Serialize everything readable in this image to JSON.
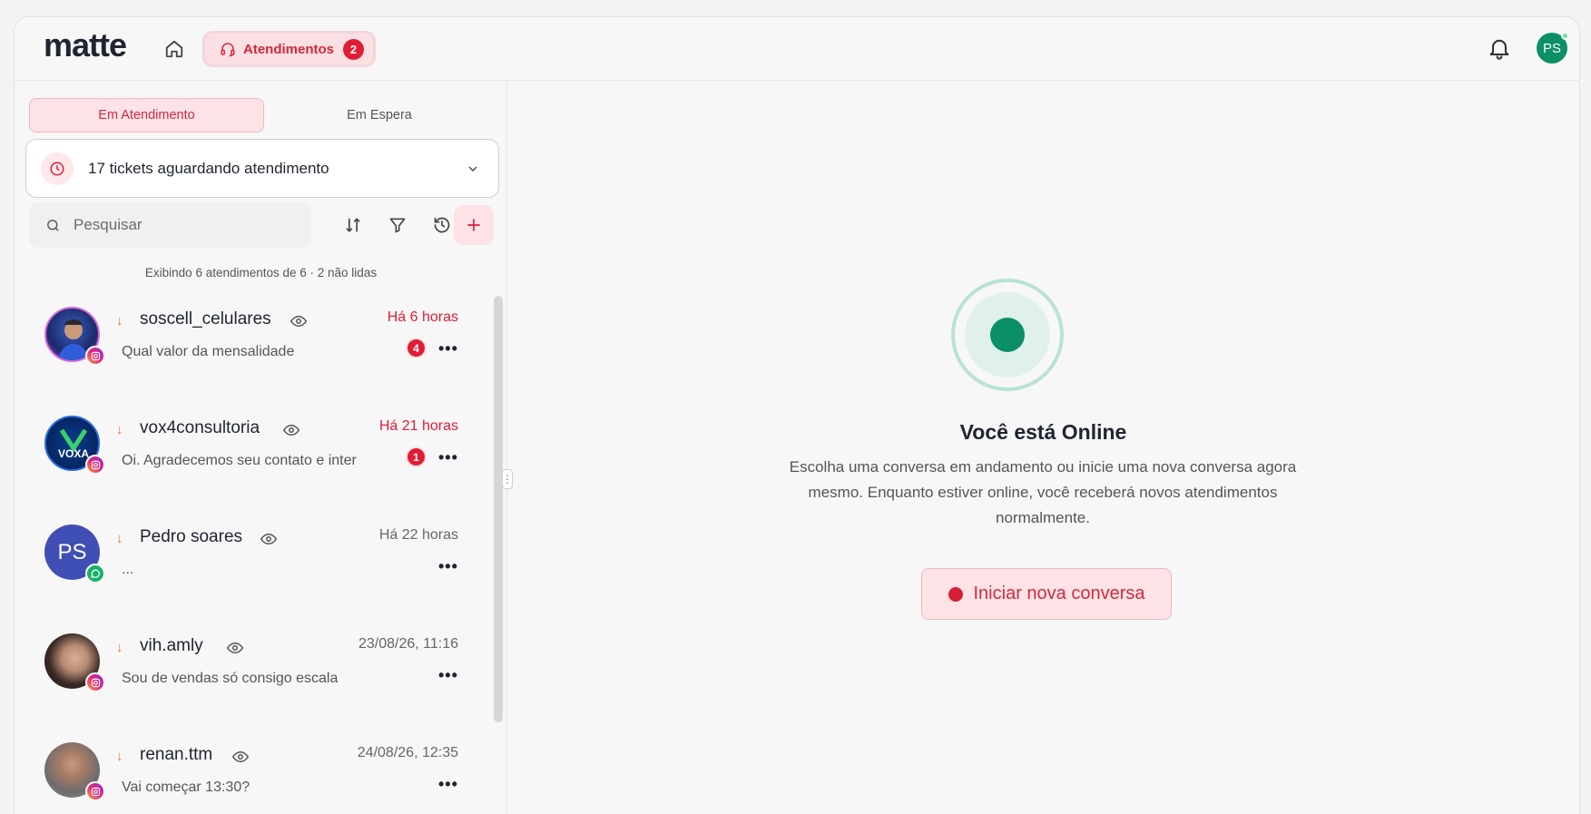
{
  "header": {
    "logo_text": "matte",
    "attendances_label": "Atendimentos",
    "attendances_badge": "2",
    "user_initials": "PS"
  },
  "sidebar": {
    "tabs": [
      {
        "label": "Em Atendimento",
        "active": true
      },
      {
        "label": "Em Espera",
        "active": false
      }
    ],
    "waiting_text": "17 tickets aguardando atendimento",
    "search_placeholder": "Pesquisar",
    "count_text": "Exibindo 6 atendimentos de 6 · 2 não lidas",
    "conversations": [
      {
        "name": "soscell_celulares",
        "time": "Há 6 horas",
        "time_urgent": true,
        "message": "Qual valor da mensalidade",
        "unread": "4",
        "channel": "instagram",
        "avatar": "photo"
      },
      {
        "name": "vox4consultoria",
        "time": "Há 21 horas",
        "time_urgent": true,
        "message": "Oi. Agradecemos seu contato e inter",
        "unread": "1",
        "channel": "instagram",
        "avatar": "logo-vox"
      },
      {
        "name": "Pedro soares",
        "time": "Há 22 horas",
        "time_urgent": false,
        "message": "...",
        "unread": "",
        "channel": "whatsapp",
        "avatar": "initials",
        "initials": "PS"
      },
      {
        "name": "vih.amly",
        "time": "23/08/26, 11:16",
        "time_urgent": false,
        "message": "Sou de vendas só consigo escala",
        "unread": "",
        "channel": "instagram",
        "avatar": "photo"
      },
      {
        "name": "renan.ttm",
        "time": "24/08/26, 12:35",
        "time_urgent": false,
        "message": "Vai começar 13:30?",
        "unread": "",
        "channel": "instagram",
        "avatar": "photo"
      }
    ]
  },
  "main": {
    "title": "Você está Online",
    "description": "Escolha uma conversa em andamento ou inicie uma nova conversa agora mesmo. Enquanto estiver online, você receberá novos atendimentos normalmente.",
    "start_button": "Iniciar nova conversa"
  },
  "colors": {
    "accent": "#e11d36",
    "online": "#0b8f67"
  },
  "icons": [
    "home-icon",
    "headset-icon",
    "bell-icon",
    "clock-icon",
    "chevron-down-icon",
    "search-icon",
    "sort-icon",
    "filter-icon",
    "history-icon",
    "plus-icon",
    "eye-icon",
    "instagram-icon",
    "whatsapp-icon",
    "more-icon"
  ]
}
